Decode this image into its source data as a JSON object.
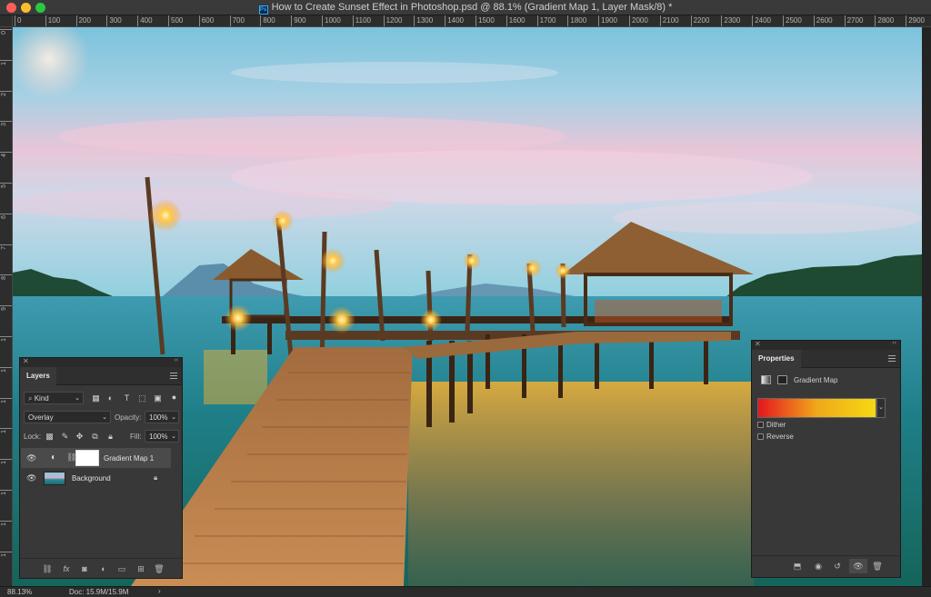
{
  "window": {
    "title": "How to Create Sunset Effect in Photoshop.psd @ 88.1% (Gradient Map 1, Layer Mask/8) *",
    "app_icon": "Ps"
  },
  "rulers": {
    "horizontal_ticks": [
      "0",
      "100",
      "200",
      "300",
      "400",
      "500",
      "600",
      "700",
      "800",
      "900",
      "1000",
      "1100",
      "1200",
      "1300",
      "1400",
      "1500",
      "1600",
      "1700",
      "1800",
      "1900",
      "2000",
      "2100",
      "2200",
      "2300",
      "2400",
      "2500",
      "2600",
      "2700",
      "2800",
      "2900"
    ],
    "vertical_ticks": [
      "0",
      "1",
      "2",
      "3",
      "4",
      "5",
      "6",
      "7",
      "8",
      "9",
      "1",
      "1",
      "1",
      "1",
      "1",
      "1",
      "1",
      "1"
    ]
  },
  "status": {
    "zoom": "88.13%",
    "doc": "Doc: 15.9M/15.9M",
    "arrow": "›"
  },
  "layers_panel": {
    "tab": "Layers",
    "filter_kind": "Kind",
    "blend_mode": "Overlay",
    "opacity_label": "Opacity:",
    "opacity_value": "100%",
    "lock_label": "Lock:",
    "fill_label": "Fill:",
    "fill_value": "100%",
    "layers": [
      {
        "name": "Gradient Map 1",
        "selected": true,
        "visible": true
      },
      {
        "name": "Background",
        "selected": false,
        "visible": true,
        "locked": true
      }
    ]
  },
  "properties_panel": {
    "tab": "Properties",
    "type_label": "Gradient Map",
    "gradient_colors": [
      "#e3171f",
      "#f0a81a",
      "#f6d913"
    ],
    "dither_label": "Dither",
    "reverse_label": "Reverse"
  },
  "icons": {
    "layer_filters": [
      "image-filter-icon",
      "adjustment-filter-icon",
      "text-filter-icon",
      "shape-filter-icon",
      "smart-object-filter-icon"
    ],
    "lock_icons": [
      "lock-pixels-icon",
      "lock-paint-icon",
      "lock-position-icon",
      "lock-artboard-icon",
      "lock-all-icon"
    ],
    "layer_bottom": [
      "link-layers-icon",
      "fx-icon",
      "add-mask-icon",
      "new-adjustment-icon",
      "new-group-icon",
      "new-layer-icon",
      "delete-layer-icon"
    ],
    "properties_bottom": [
      "clip-to-layer-icon",
      "view-previous-icon",
      "reset-icon",
      "toggle-visibility-icon",
      "delete-adjustment-icon"
    ]
  }
}
